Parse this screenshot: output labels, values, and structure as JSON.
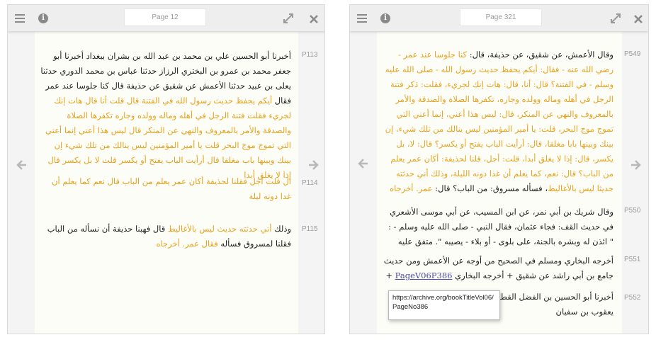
{
  "left_panel": {
    "page_label": "Page 12",
    "refs": [
      "P113",
      "P114",
      "P115"
    ],
    "p113": {
      "plain": "أخبرنا أبو الحسين علي بن محمد بن عبد الله بن بشران ببغداد أخبرنا أبو جعفر محمد بن عمرو بن البختري الرزاز حدثنا عباس بن محمد الدوري حدثنا يعلى بن عبيد حدثنا الأعمش عن شقيق عن حذيفة قال كنا جلوسا عند عمر فقال ",
      "orange": "أيكم يحفظ حديث رسول الله في الفتنة قال قلت أنا قال هات إنك لجريء فقلت فتنة الرجل في أهله وماله وولده وجاره تكفرها الصلاة والصدقة والأمر بالمعروف والنهي عن المنكر قال ليس هذا أعني إنما أعني التي تموج موج البحر قلت يا أمير المؤمنين ليس ينالك من تلك شيء إن بينك وبينها باب مغلقا قال أرأيت الباب يفتح أو يكسر قلت لا بل يكسر قال إذا لا يغلق أبدا"
    },
    "p114": {
      "orange": "ال قلت أجل فقلنا لحذيفة أكان عمر يعلم من الباب قال نعم كما يعلم أن غدا دونه ليلة"
    },
    "p115": {
      "plain_start": "وذلك ",
      "orange_1": "أني حدثته حديث ليس بالأغاليط",
      "plain_mid": " قال فهبنا حذيفة أن نسأله من الباب فقلنا لمسروق فسأله ",
      "orange_2": "فقال عمر. أخرجاه"
    }
  },
  "right_panel": {
    "page_label": "Page 321",
    "refs": [
      "P549",
      "P550",
      "P551",
      "P552"
    ],
    "p549": {
      "plain_start": "وقال الأعمش، عن شقيق، عن حذيفة، قال: ",
      "orange": "كنا جلوسا عند عمر - رضي الله عنه - فقال: أيكم يحفظ حديث رسول الله - صلى الله عليه وسلم - في الفتنة؟ قال: أنا، قال: هات إنك لجريء، فقلت: ذكر فتنة الرجل في أهله وماله وولده وجاره، تكفرها الصلاة والصدقة والأمر بالمعروف والنهي عن المنكر، قال: ليس هذا أعني، إنما أعني التي تموج موج البحر، قلت: يا أمير المؤمنين ليس ينالك من تلك شيء، إن بينك وبينها بابا مغلقا، قال: أرأيت الباب يفتح أو يكسر؟ قال: لا، بل يكسر، قال: إذا لا يغلق أبدا، قلت: أجل، قلنا لحذيفة: أكان عمر يعلم من الباب؟ قال: نعم، كما يعلم أن غدا دونه الليلة، وذلك أني حدثته حديثا ليس بالأغاليط",
      "plain_mid": "، فسأله مسروق: من الباب؟ قال: ",
      "orange_end": "عمر. أخرجاه"
    },
    "p550": {
      "plain": "وقال شريك بن أبي نمر، عن ابن المسيب، عن أبي موسى الأشعري في حديث القف: فجاء عثمان، فقال النبي - صلى الله عليه وسلم - : \" ائذن له وبشره بالجنة، على بلوى - أو بلاء - يصيبه \". متفق عليه"
    },
    "p551": {
      "plain": "أخرجه البخاري ومسلم في الصحيح من أوجه عن الأعمش ومن حديث جامع بن أبي راشد عن شقيق + أخرجه البخاري ",
      "link": "PageV06P386",
      "plus": " +"
    },
    "p552": {
      "plain": "أخبرنا أبو الحسين بن الفضل القطان أخبرنا عبد الله بن جعفر حدثنا يعقوب بن سفيان"
    },
    "tooltip": "https://archive.org/bookTitleVol06/PageNo386"
  },
  "icons": {
    "menu": "menu-icon",
    "info": "info-icon",
    "expand": "expand-icon",
    "close": "close-icon",
    "prev": "arrow-left-icon",
    "next": "arrow-right-icon"
  },
  "colors": {
    "highlight": "#e8a21e",
    "link": "#4a4aa8",
    "text": "#222222",
    "muted": "#9a9a9a"
  }
}
